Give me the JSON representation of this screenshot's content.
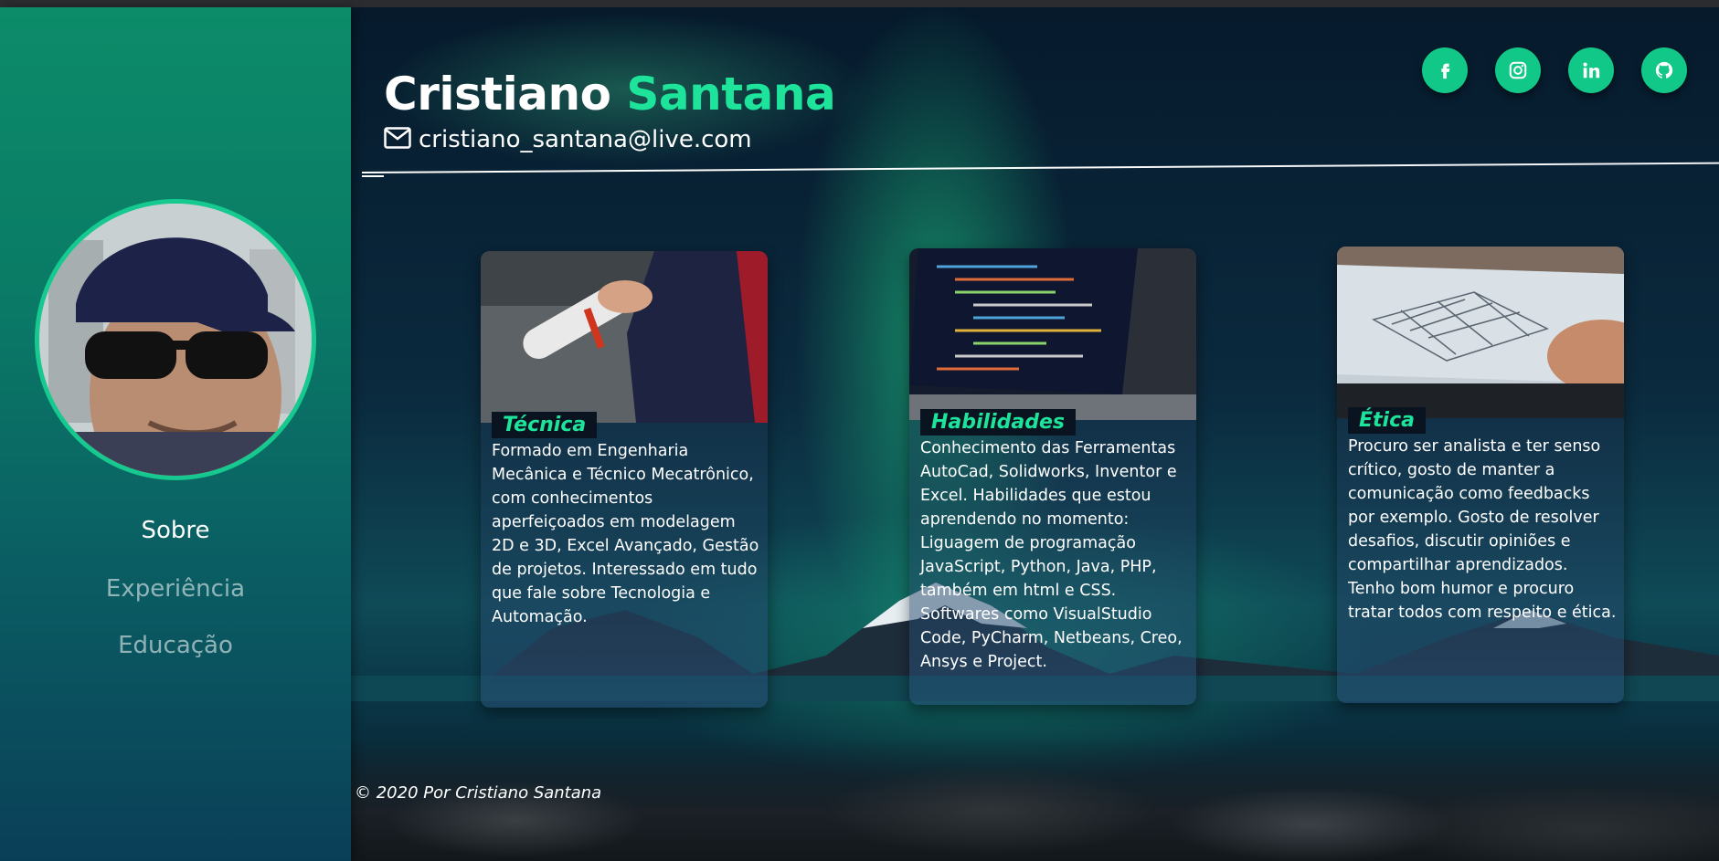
{
  "header": {
    "first_name": "Cristiano",
    "last_name": "Santana",
    "email": "cristiano_santana@live.com"
  },
  "sidebar": {
    "nav": [
      {
        "label": "Sobre",
        "active": true
      },
      {
        "label": "Experiência",
        "active": false
      },
      {
        "label": "Educação",
        "active": false
      }
    ]
  },
  "social": [
    {
      "icon": "facebook-icon"
    },
    {
      "icon": "instagram-icon"
    },
    {
      "icon": "linkedin-icon"
    },
    {
      "icon": "github-icon"
    }
  ],
  "cards": [
    {
      "title": "Técnica",
      "text": "Formado em Engenharia Mecânica e Técnico Mecatrônico, com conhecimentos aperfeiçoados em modelagem 2D e 3D, Excel Avançado, Gestão de projetos. Interessado em tudo que fale sobre Tecnologia e Automação."
    },
    {
      "title": "Habilidades",
      "text": "Conhecimento das Ferramentas AutoCad, Solidworks, Inventor e Excel. Habilidades que estou aprendendo no momento: Liguagem de programação JavaScript, Python, Java, PHP, também em html e CSS. Softwares como VisualStudio Code, PyCharm, Netbeans, Creo, Ansys e Project."
    },
    {
      "title": "Ética",
      "text": "Procuro ser analista e ter senso crítico, gosto de manter a comunicação como feedbacks por exemplo. Gosto de resolver desafios, discutir opiniões e compartilhar aprendizados. Tenho bom humor e procuro tratar todos com respeito e ética."
    }
  ],
  "footer": {
    "text": "© 2020 Por Cristiano Santana"
  },
  "colors": {
    "accent": "#1ee39a",
    "sidebar_top": "#0c8c69",
    "social_button": "#12c889"
  }
}
